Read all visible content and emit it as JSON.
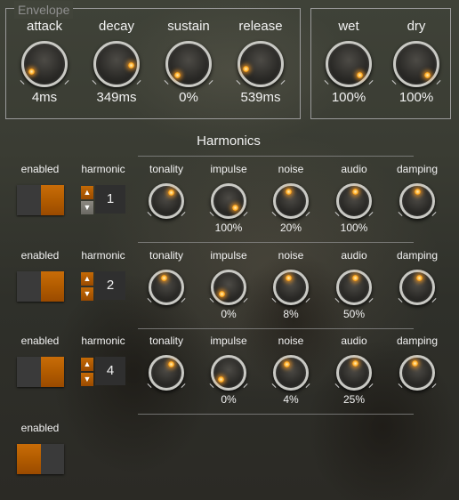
{
  "envelope": {
    "legend": "Envelope",
    "knobs": [
      {
        "label": "attack",
        "value": "4ms",
        "level": 0.05
      },
      {
        "label": "decay",
        "value": "349ms",
        "level": 0.85
      },
      {
        "label": "sustain",
        "value": "0%",
        "level": 0.0
      },
      {
        "label": "release",
        "value": "539ms",
        "level": 0.1
      }
    ]
  },
  "mix": {
    "knobs": [
      {
        "label": "wet",
        "value": "100%",
        "level": 1.0
      },
      {
        "label": "dry",
        "value": "100%",
        "level": 1.0
      }
    ]
  },
  "harmonics": {
    "title": "Harmonics",
    "headers": {
      "enabled": "enabled",
      "harmonic": "harmonic",
      "tonality": "tonality",
      "impulse": "impulse",
      "noise": "noise",
      "audio": "audio",
      "damping": "damping"
    },
    "rows": [
      {
        "harmonic": "1",
        "enabled": true,
        "harmonic_down_disabled": true,
        "tonality": 0.62,
        "impulse": {
          "value": "100%",
          "level": 1.0
        },
        "noise": {
          "value": "20%",
          "level": 0.45
        },
        "audio": {
          "value": "100%",
          "level": 0.52
        },
        "damping": 0.5
      },
      {
        "harmonic": "2",
        "enabled": true,
        "harmonic_down_disabled": false,
        "tonality": 0.45,
        "impulse": {
          "value": "0%",
          "level": 0.0
        },
        "noise": {
          "value": "8%",
          "level": 0.45
        },
        "audio": {
          "value": "50%",
          "level": 0.52
        },
        "damping": 0.55
      },
      {
        "harmonic": "4",
        "enabled": true,
        "harmonic_down_disabled": false,
        "tonality": 0.62,
        "impulse": {
          "value": "0%",
          "level": 0.02
        },
        "noise": {
          "value": "4%",
          "level": 0.4
        },
        "audio": {
          "value": "25%",
          "level": 0.52
        },
        "damping": 0.45
      }
    ],
    "footer": {
      "label": "enabled",
      "enabled": false
    }
  },
  "colors": {
    "accent": "#b25c00",
    "off": "#3a3a3a",
    "text": "#f2f2f2"
  }
}
